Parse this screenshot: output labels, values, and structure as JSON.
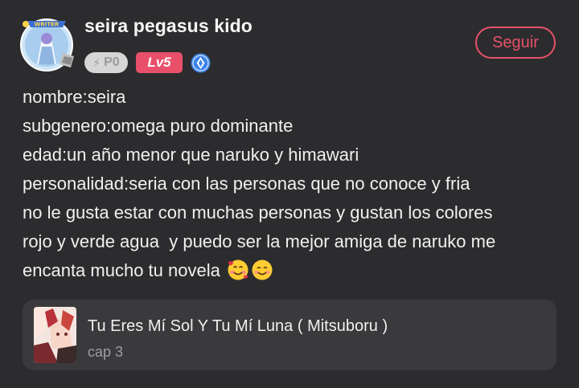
{
  "profile": {
    "username": "seira pegasus kido",
    "avatar_badge_text": "WRITER",
    "points_label": "P0",
    "level_label": "Lv5",
    "follow_label": "Seguir"
  },
  "post": {
    "lines": [
      "nombre:seira",
      "subgenero:omega puro dominante",
      "edad:un año menor que naruko y himawari",
      "personalidad:seria con las personas que no conoce y fria",
      "no le gusta estar con muchas personas y gustan los colores",
      "rojo y verde agua  y puedo ser la mejor amiga de naruko me",
      "encanta mucho tu novela"
    ],
    "emojis": [
      "smiling-face-with-hearts",
      "smiling-face"
    ]
  },
  "linked_story": {
    "title": "Tu Eres Mí Sol Y Tu Mí Luna ( Mitsuboru )",
    "chapter": "cap 3"
  },
  "colors": {
    "background": "#2c2c2e",
    "card_background": "#3a3a3c",
    "accent": "#e8506a",
    "gem": "#3b82e6"
  }
}
